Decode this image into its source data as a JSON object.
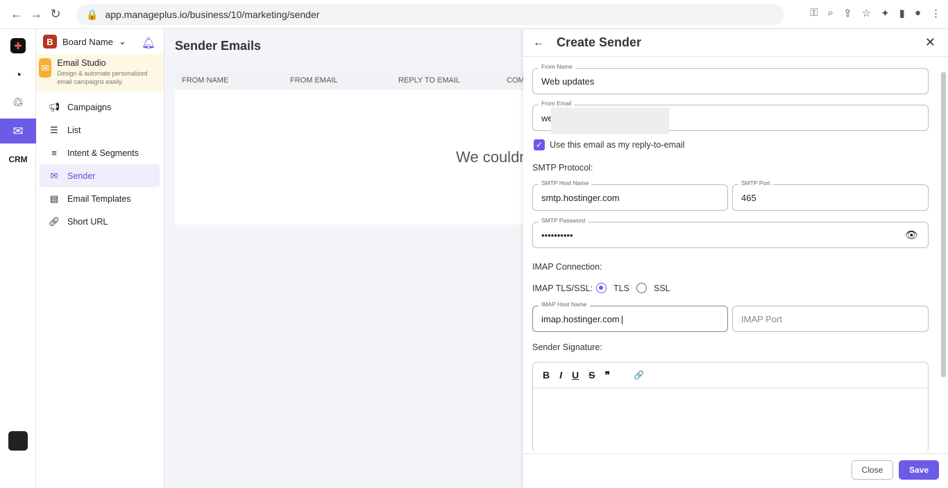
{
  "browser": {
    "url": "app.manageplus.io/business/10/marketing/sender"
  },
  "rail": {
    "items": [
      "apps",
      "dashboard",
      "segments",
      "email-studio",
      "crm"
    ],
    "crm_label": "CRM"
  },
  "sidebar": {
    "board_name": "Board Name",
    "studio_title": "Email Studio",
    "studio_desc": "Design & automate personalized email campaigns easily.",
    "items": [
      {
        "label": "Campaigns",
        "icon": "megaphone-icon"
      },
      {
        "label": "List",
        "icon": "list-icon"
      },
      {
        "label": "Intent & Segments",
        "icon": "lines-icon"
      },
      {
        "label": "Sender",
        "icon": "sender-icon",
        "selected": true
      },
      {
        "label": "Email Templates",
        "icon": "template-icon"
      },
      {
        "label": "Short URL",
        "icon": "link-icon"
      }
    ]
  },
  "main": {
    "title": "Sender Emails",
    "columns": [
      "FROM NAME",
      "FROM EMAIL",
      "REPLY TO EMAIL",
      "COM"
    ],
    "empty": "We couldn"
  },
  "panel": {
    "title": "Create Sender",
    "from_name_label": "From Name",
    "from_name": "Web updates",
    "from_email_label": "From Email",
    "from_email": "we",
    "reply_checkbox": "Use this email as my reply-to-email",
    "smtp_heading": "SMTP Protocol:",
    "smtp_host_label": "SMTP Host Name",
    "smtp_host": "smtp.hostinger.com",
    "smtp_port_label": "SMTP Port",
    "smtp_port": "465",
    "smtp_pass_label": "SMTP Password",
    "smtp_pass": "••••••••••",
    "imap_heading": "IMAP Connection:",
    "imap_tls_label": "IMAP TLS/SSL:",
    "tls": "TLS",
    "ssl": "SSL",
    "tls_selected": true,
    "imap_host_label": "IMAP Host Name",
    "imap_host": "imap.hostinger.com",
    "imap_port_placeholder": "IMAP Port",
    "signature_heading": "Sender Signature:",
    "toolbar": [
      "B",
      "I",
      "U",
      "S",
      "❞",
      "🔗"
    ],
    "close": "Close",
    "save": "Save"
  },
  "colors": {
    "accent": "#6b5ce7"
  }
}
